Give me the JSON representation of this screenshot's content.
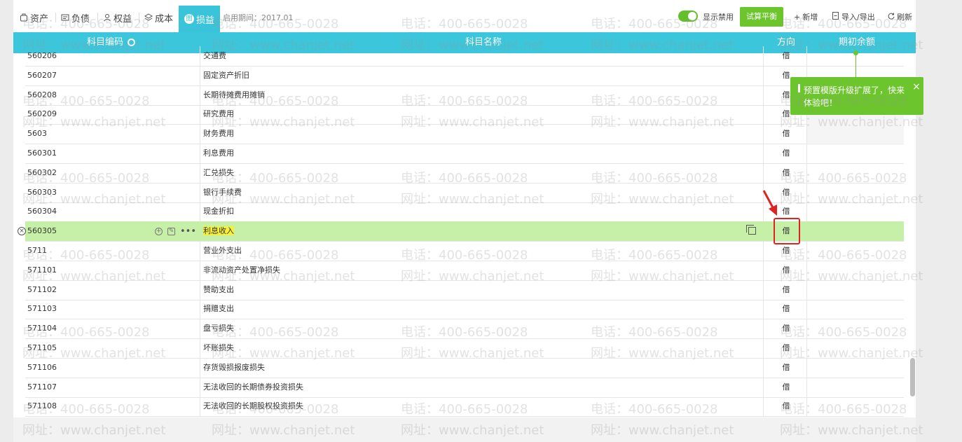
{
  "tabs": [
    {
      "label": "资产",
      "icon": "asset-icon"
    },
    {
      "label": "负债",
      "icon": "liability-icon"
    },
    {
      "label": "权益",
      "icon": "equity-icon"
    },
    {
      "label": "成本",
      "icon": "cost-icon"
    },
    {
      "label": "损益",
      "icon": "profit-loss-icon",
      "icon_char": "图",
      "active": true
    }
  ],
  "start_period": "启用期间：2017.01",
  "toolbar": {
    "show_disabled_label": "显示禁用",
    "show_disabled_on": true,
    "trial_balance_label": "试算平衡",
    "add_label": "新增",
    "import_export_label": "导入/导出",
    "refresh_label": "刷新"
  },
  "table": {
    "headers": {
      "code": "科目编码",
      "name": "科目名称",
      "direction": "方向",
      "opening_balance": "期初余额"
    },
    "rows": [
      {
        "code": "560206",
        "name": "交通费",
        "direction": "借"
      },
      {
        "code": "560207",
        "name": "固定资产折旧",
        "direction": "借"
      },
      {
        "code": "560208",
        "name": "长期待摊费用摊销",
        "direction": "借"
      },
      {
        "code": "560209",
        "name": "研究费用",
        "direction": "借"
      },
      {
        "code": "5603",
        "name": "财务费用",
        "direction": "借"
      },
      {
        "code": "560301",
        "name": "利息费用",
        "direction": "借"
      },
      {
        "code": "560302",
        "name": "汇兑损失",
        "direction": "借"
      },
      {
        "code": "560303",
        "name": "银行手续费",
        "direction": "借"
      },
      {
        "code": "560304",
        "name": "现金折扣",
        "direction": "借"
      },
      {
        "code": "560305",
        "name": "利息收入",
        "direction": "借",
        "selected": true
      },
      {
        "code": "5711",
        "name": "营业外支出",
        "direction": "借"
      },
      {
        "code": "571101",
        "name": "非流动资产处置净损失",
        "direction": "借"
      },
      {
        "code": "571102",
        "name": "赞助支出",
        "direction": "借"
      },
      {
        "code": "571103",
        "name": "捐赠支出",
        "direction": "借"
      },
      {
        "code": "571104",
        "name": "盘亏损失",
        "direction": "借"
      },
      {
        "code": "571105",
        "name": "坏账损失",
        "direction": "借"
      },
      {
        "code": "571106",
        "name": "存货毁损报废损失",
        "direction": "借"
      },
      {
        "code": "571107",
        "name": "无法收回的长期债券投资损失",
        "direction": "借"
      },
      {
        "code": "571108",
        "name": "无法收回的长期股权投资损失",
        "direction": "借"
      }
    ]
  },
  "tooltip": {
    "text": "预置模版升级扩展了，快来体验吧！",
    "close_glyph": "×"
  },
  "watermark": {
    "phone": "电话：400-665-0028",
    "site": "网址：www.chanjet.net"
  },
  "colors": {
    "header_bg": "#3bc6db",
    "accent_green": "#6cc52d",
    "selected_row_bg": "#c6efa8",
    "highlight_text_bg": "#f7f03a",
    "annotation_red": "#e02222"
  }
}
